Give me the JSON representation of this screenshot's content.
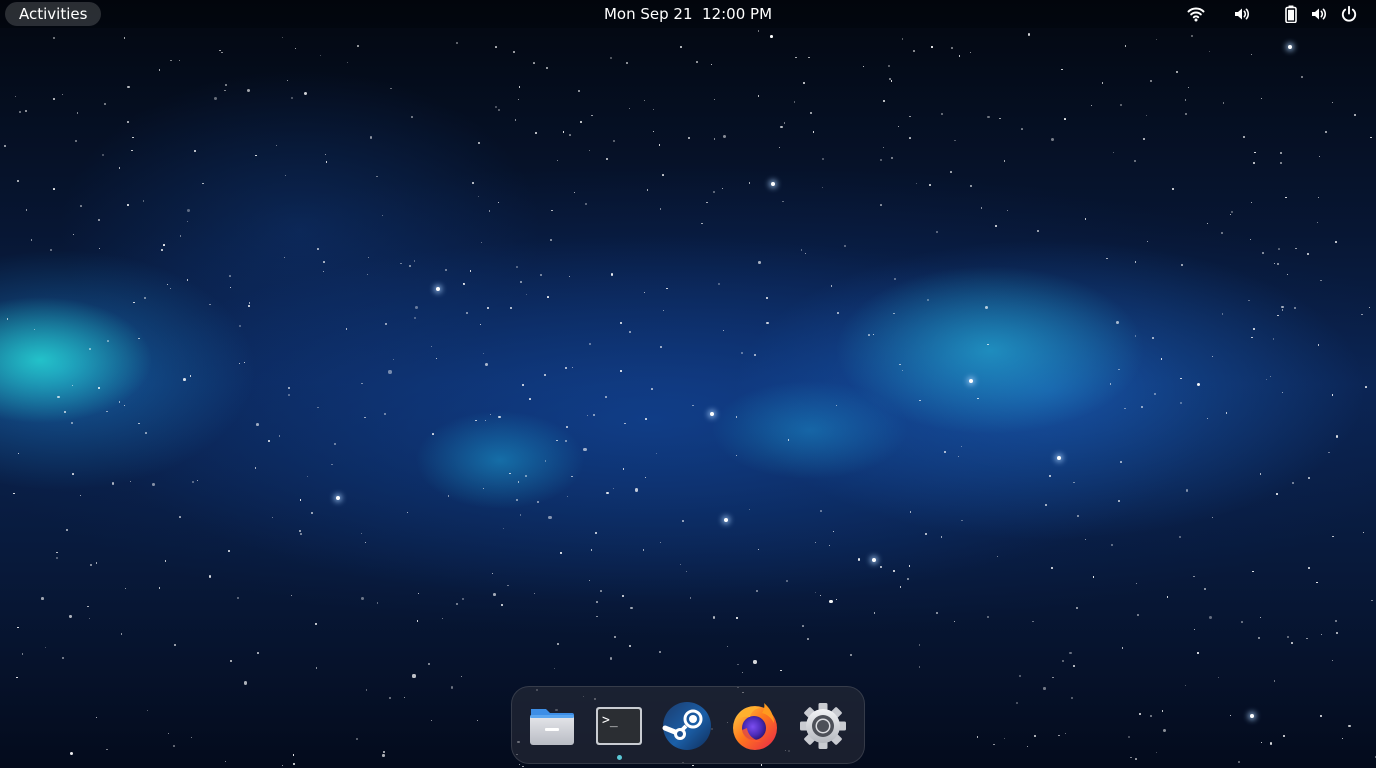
{
  "topbar": {
    "activities_label": "Activities",
    "clock": "Mon Sep 21  12:00 PM",
    "tray_icons": [
      "wifi-icon",
      "volume-icon",
      "battery-icon",
      "volume-icon",
      "power-icon"
    ]
  },
  "dock": {
    "apps": [
      {
        "name": "files",
        "icon": "folder-icon"
      },
      {
        "name": "terminal",
        "icon": "terminal-icon",
        "glyph": ">_",
        "running": true
      },
      {
        "name": "steam",
        "icon": "steam-icon"
      },
      {
        "name": "firefox",
        "icon": "firefox-icon"
      },
      {
        "name": "settings",
        "icon": "gear-icon"
      }
    ]
  },
  "colors": {
    "running_indicator": "#5bc8d6",
    "nebula_cyan": "#28e6dc",
    "nebula_blue": "#1e6ed2"
  }
}
